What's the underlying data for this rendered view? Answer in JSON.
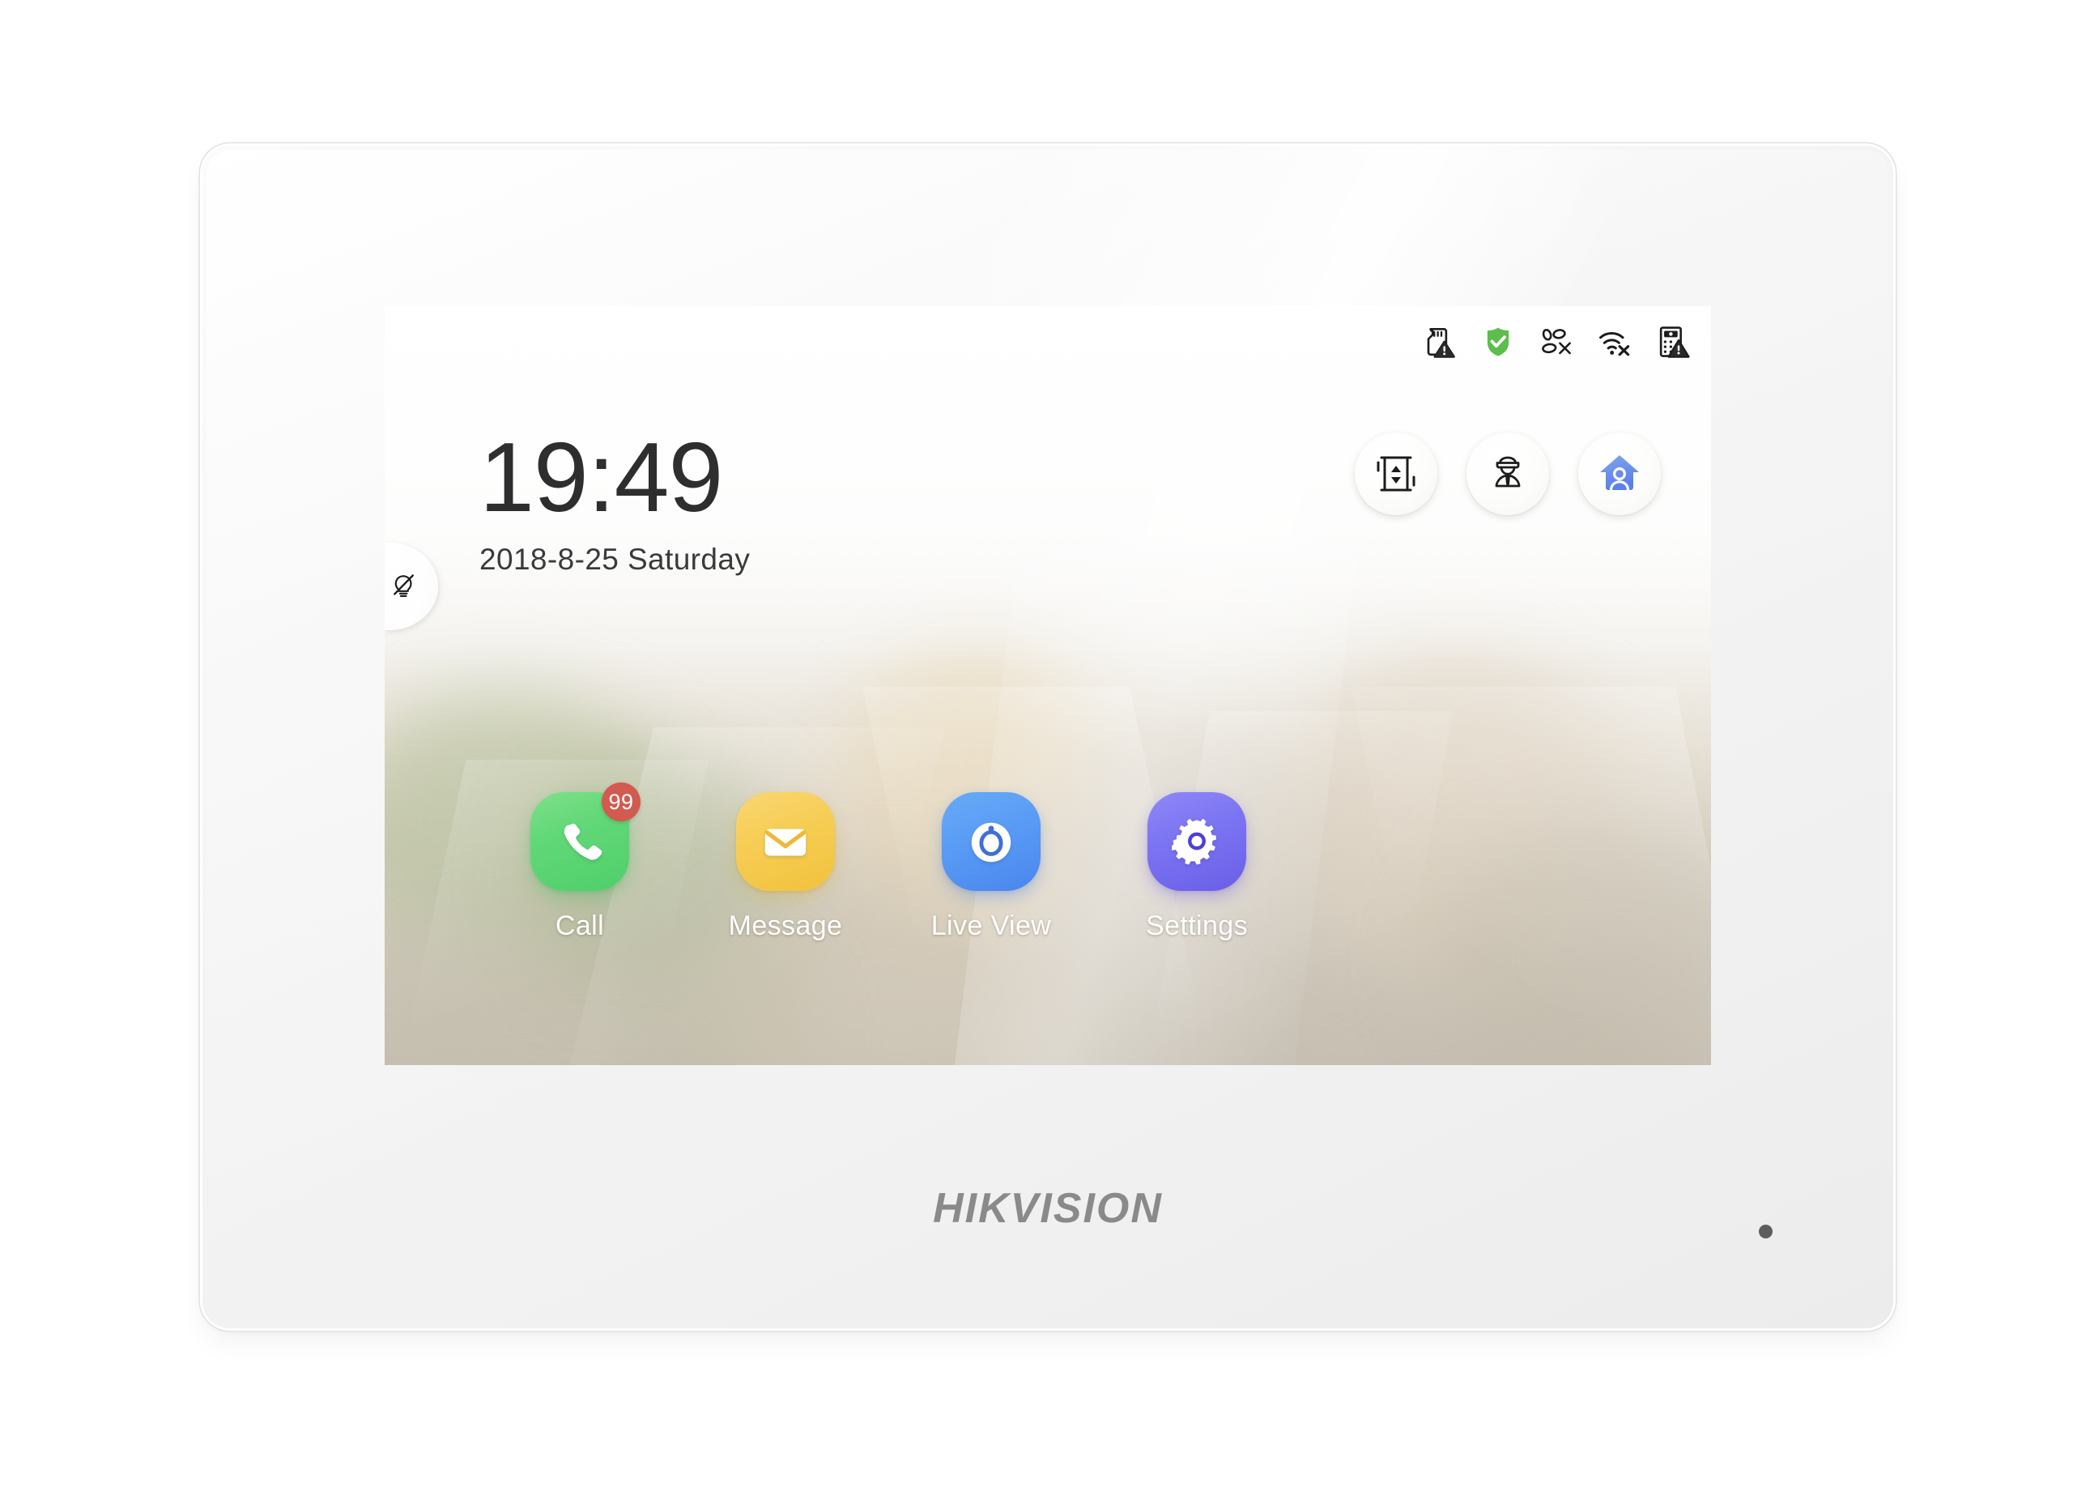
{
  "device": {
    "brand": "HIKVISION",
    "indicator_led": "led-dot"
  },
  "status_bar": {
    "icons": [
      {
        "name": "sd-card-warning-icon",
        "label": "SD Card Error",
        "color": "#1c1c1c"
      },
      {
        "name": "shield-armed-icon",
        "label": "Armed",
        "color": "#5cbe4b"
      },
      {
        "name": "call-forward-off-icon",
        "label": "Call Forwarding Disabled",
        "color": "#1c1c1c"
      },
      {
        "name": "wifi-disconnected-icon",
        "label": "Wi-Fi Disconnected",
        "color": "#1c1c1c"
      },
      {
        "name": "door-station-warning-icon",
        "label": "Door Station Offline",
        "color": "#1c1c1c"
      }
    ]
  },
  "clock": {
    "time": "19:49",
    "date": "2018-8-25  Saturday"
  },
  "quick_actions": [
    {
      "name": "elevator-button",
      "icon": "elevator-icon",
      "label": "Elevator"
    },
    {
      "name": "security-guard-button",
      "icon": "guard-icon",
      "label": "Call Center"
    },
    {
      "name": "stay-arming-button",
      "icon": "home-person-icon",
      "label": "Stay Arming"
    }
  ],
  "light_tab": {
    "name": "light-toggle",
    "icon": "light-bulb-off-icon",
    "label": "Light"
  },
  "apps": [
    {
      "name": "app-call",
      "label": "Call",
      "icon": "phone-icon",
      "color": "#57d372",
      "badge": "99",
      "badge_color": "#d25a4f"
    },
    {
      "name": "app-message",
      "label": "Message",
      "icon": "envelope-icon",
      "color": "#f4c84a",
      "badge": null,
      "badge_color": null
    },
    {
      "name": "app-live-view",
      "label": "Live View",
      "icon": "camera-lens-icon",
      "color": "#5190f1",
      "badge": null,
      "badge_color": null
    },
    {
      "name": "app-settings",
      "label": "Settings",
      "icon": "gear-icon",
      "color": "#7469ed",
      "badge": null,
      "badge_color": null
    }
  ]
}
